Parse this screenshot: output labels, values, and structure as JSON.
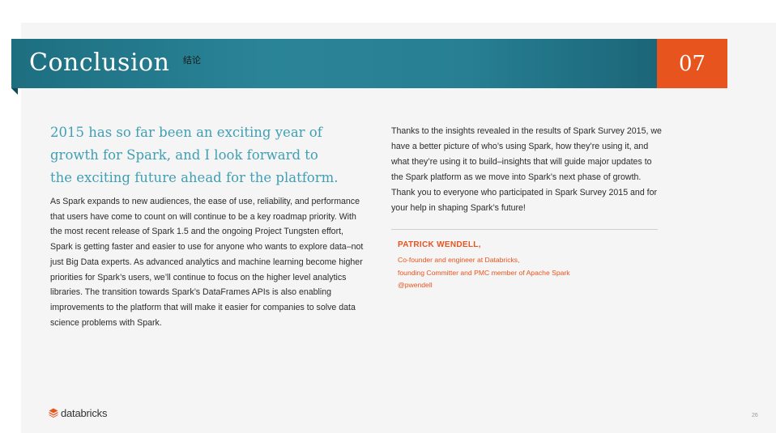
{
  "header": {
    "title": "Conclusion",
    "annotation_cn": "结论",
    "chapter": "07"
  },
  "left": {
    "lead": "2015 has so far been an exciting year of growth for Spark, and I look forward to the exciting future ahead for the platform.",
    "body": "As Spark expands to new audiences, the ease of use, reliability, and performance that users have come to count on will continue to be a key roadmap priority. With the most recent release of Spark 1.5 and the ongoing Project Tungsten effort, Spark is getting faster and easier to use for anyone who wants to explore data–not just Big Data experts. As advanced analytics and machine learning become higher priorities for Spark’s users, we’ll continue to focus on the higher level analytics libraries. The transition towards Spark’s DataFrames APIs is also enabling improvements to the platform that will make it easier for companies to solve data science problems with Spark."
  },
  "right": {
    "body": "Thanks to the insights revealed in the results of Spark Survey 2015, we have a better picture of who’s using Spark, how they’re using it, and what they’re using it to build–insights that will guide major updates to the Spark platform as we move into Spark’s next phase of growth. Thank you to everyone who participated in Spark Survey 2015 and for your help in shaping Spark’s future!",
    "author": {
      "name": "PATRICK WENDELL,",
      "line1": "Co-founder and engineer at Databricks,",
      "line2": "founding  Committer and PMC member of Apache  Spark",
      "handle": "@pwendell"
    }
  },
  "footer": {
    "logo_text": "databricks",
    "page_number": "26"
  },
  "colors": {
    "banner_teal": "#2a8498",
    "accent_orange": "#e8541e",
    "lead_teal": "#3f9fb4"
  }
}
